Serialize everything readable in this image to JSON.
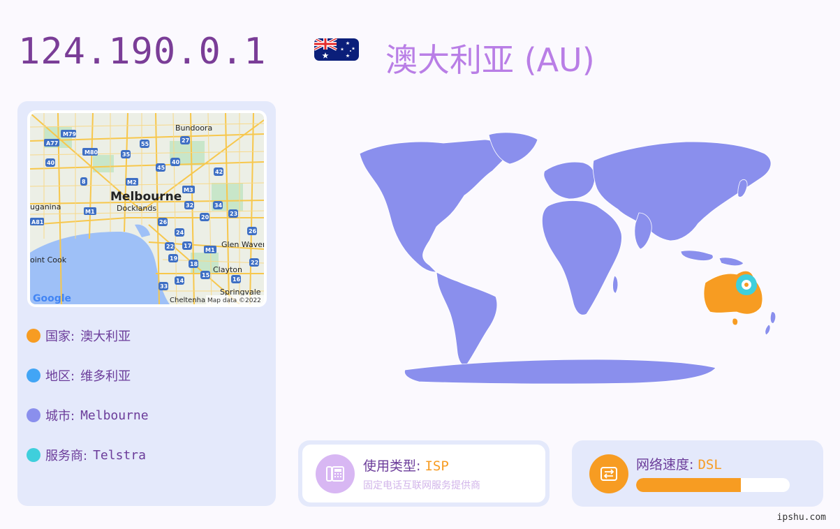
{
  "header": {
    "ip": "124.190.0.1",
    "country_title": "澳大利亚 (AU)",
    "flag_icon": "australia-flag-icon"
  },
  "mini_map": {
    "labels": {
      "city": "Melbourne",
      "docklands": "Docklands",
      "bundoora": "Bundoora",
      "glen_waverley": "Glen Waver",
      "clayton": "Clayton",
      "springvale": "Springvale",
      "point_cook": "oint Cook",
      "truganina": "uganina",
      "cheltenham": "Cheltenha",
      "attribution": "Map data ©2022",
      "logo": "Google"
    },
    "route_shields": [
      "M79",
      "A77",
      "M80",
      "35",
      "55",
      "27",
      "40",
      "45",
      "40",
      "42",
      "8",
      "M2",
      "M3",
      "M1",
      "32",
      "34",
      "A81",
      "26",
      "20",
      "23",
      "24",
      "26",
      "22",
      "17",
      "M1",
      "19",
      "18",
      "22",
      "15",
      "14",
      "16",
      "33"
    ],
    "colors": {
      "water": "#9ec0f7",
      "land": "#ecefe6",
      "park": "#c8e6c9",
      "road": "#f7c74c",
      "shield": "#3e6fc4"
    }
  },
  "info": {
    "country": {
      "label": "国家:",
      "value": "澳大利亚",
      "color": "#f79c22"
    },
    "region": {
      "label": "地区:",
      "value": "维多利亚",
      "color": "#42a5f5"
    },
    "city": {
      "label": "城市:",
      "value": "Melbourne",
      "color": "#8a8fed"
    },
    "isp": {
      "label": "服务商:",
      "value": "Telstra",
      "color": "#3fcfdc"
    }
  },
  "world_map": {
    "land_color": "#8a8fed",
    "highlight_color": "#f79c22",
    "marker_color": "#3fcfdc",
    "marker_icon": "location-pin-icon"
  },
  "usage_card": {
    "title": "使用类型:",
    "value": "ISP",
    "subtitle": "固定电话互联网服务提供商",
    "icon": "telephone-icon",
    "icon_bg": "#d8b7f3"
  },
  "speed_card": {
    "title": "网络速度:",
    "value": "DSL",
    "progress": 0.68,
    "icon": "network-drive-icon",
    "icon_bg": "#f79c22"
  },
  "footer": {
    "site": "ipshu.com"
  }
}
